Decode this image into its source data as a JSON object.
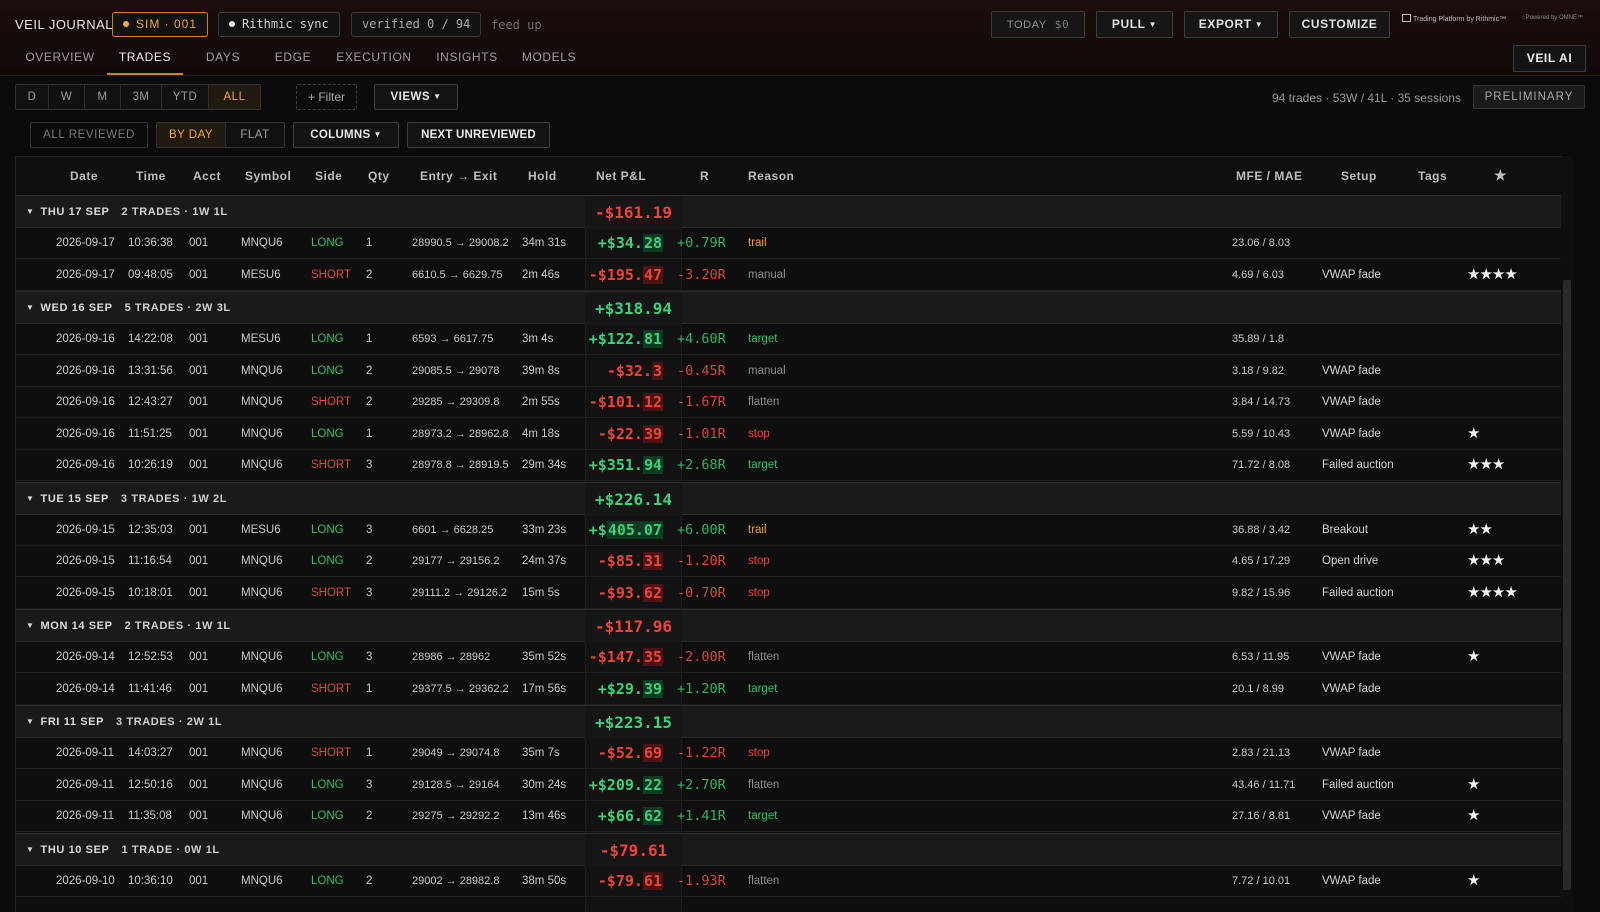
{
  "header": {
    "brand": "VEIL JOURNAL",
    "account_pill": "SIM · 001",
    "sync_pill": "Rithmic sync",
    "verified": "verified 0 / 94",
    "feed": "feed up",
    "today_label": "TODAY",
    "today_value": "$0",
    "pull": "PULL",
    "export": "EXPORT",
    "customize": "CUSTOMIZE",
    "platform_badge": "Trading Platform by Rithmic™",
    "powered": "Powered by OMNE™",
    "veil_ai": "VEIL AI",
    "colors": {
      "accent": "#c58a16",
      "positive": "#3bd27a",
      "negative": "#ee4336"
    }
  },
  "tabs": [
    "OVERVIEW",
    "TRADES",
    "DAYS",
    "EDGE",
    "EXECUTION",
    "INSIGHTS",
    "MODELS"
  ],
  "active_tab": "TRADES",
  "range": {
    "options": [
      "D",
      "W",
      "M",
      "3M",
      "YTD",
      "ALL"
    ],
    "selected": "ALL"
  },
  "filter_label": "+ Filter",
  "views_label": "VIEWS",
  "summary": "94 trades · 53W / 41L · 35 sessions",
  "preliminary": "PRELIMINARY",
  "toolbar": {
    "all_reviewed": "ALL REVIEWED",
    "by_day": "BY DAY",
    "flat": "FLAT",
    "columns": "COLUMNS",
    "next_unreviewed": "NEXT UNREVIEWED"
  },
  "columns": {
    "date": "Date",
    "time": "Time",
    "acct": "Acct",
    "symbol": "Symbol",
    "side": "Side",
    "qty": "Qty",
    "entry_exit": "Entry → Exit",
    "hold": "Hold",
    "net_pnl": "Net P&L",
    "r": "R",
    "reason": "Reason",
    "mfe_mae": "MFE / MAE",
    "setup": "Setup",
    "tags": "Tags",
    "star": "★"
  },
  "groups": [
    {
      "label": "THU 17 SEP",
      "count": "2 TRADES · 1W 1L",
      "pnl": "-$161.19",
      "sign": "neg",
      "trades": [
        {
          "date": "2026-09-17",
          "time": "10:36:38",
          "acct": "001",
          "symbol": "MNQU6",
          "side": "LONG",
          "qty": "1",
          "entry_exit": "28990.5 → 29008.2",
          "hold": "34m 31s",
          "pnl_a": "+$34.",
          "pnl_b": "28",
          "sign": "pos",
          "r": "+0.79R",
          "reason": "trail",
          "mfe_mae": "23.06 / 8.03",
          "setup": "",
          "stars": ""
        },
        {
          "date": "2026-09-17",
          "time": "09:48:05",
          "acct": "001",
          "symbol": "MESU6",
          "side": "SHORT",
          "qty": "2",
          "entry_exit": "6610.5 → 6629.75",
          "hold": "2m 46s",
          "pnl_a": "-$195.",
          "pnl_b": "47",
          "sign": "neg",
          "r": "-3.20R",
          "reason": "manual",
          "mfe_mae": "4.69 / 6.03",
          "setup": "VWAP fade",
          "stars": "★★★★"
        }
      ]
    },
    {
      "label": "WED 16 SEP",
      "count": "5 TRADES · 2W 3L",
      "pnl": "+$318.94",
      "sign": "pos",
      "trades": [
        {
          "date": "2026-09-16",
          "time": "14:22:08",
          "acct": "001",
          "symbol": "MESU6",
          "side": "LONG",
          "qty": "1",
          "entry_exit": "6593 → 6617.75",
          "hold": "3m 4s",
          "pnl_a": "+$122.",
          "pnl_b": "81",
          "sign": "pos",
          "r": "+4.60R",
          "reason": "target",
          "mfe_mae": "35.89 / 1.8",
          "setup": "",
          "stars": ""
        },
        {
          "date": "2026-09-16",
          "time": "13:31:56",
          "acct": "001",
          "symbol": "MNQU6",
          "side": "LONG",
          "qty": "2",
          "entry_exit": "29085.5 → 29078",
          "hold": "39m 8s",
          "pnl_a": "-$32.",
          "pnl_b": "3",
          "sign": "neg",
          "r": "-0.45R",
          "reason": "manual",
          "mfe_mae": "3.18 / 9.82",
          "setup": "VWAP fade",
          "stars": ""
        },
        {
          "date": "2026-09-16",
          "time": "12:43:27",
          "acct": "001",
          "symbol": "MNQU6",
          "side": "SHORT",
          "qty": "2",
          "entry_exit": "29285 → 29309.8",
          "hold": "2m 55s",
          "pnl_a": "-$101.",
          "pnl_b": "12",
          "sign": "neg",
          "r": "-1.67R",
          "reason": "flatten",
          "mfe_mae": "3.84 / 14.73",
          "setup": "VWAP fade",
          "stars": ""
        },
        {
          "date": "2026-09-16",
          "time": "11:51:25",
          "acct": "001",
          "symbol": "MNQU6",
          "side": "LONG",
          "qty": "1",
          "entry_exit": "28973.2 → 28962.8",
          "hold": "4m 18s",
          "pnl_a": "-$22.",
          "pnl_b": "39",
          "sign": "neg",
          "r": "-1.01R",
          "reason": "stop",
          "mfe_mae": "5.59 / 10.43",
          "setup": "VWAP fade",
          "stars": "★"
        },
        {
          "date": "2026-09-16",
          "time": "10:26:19",
          "acct": "001",
          "symbol": "MNQU6",
          "side": "SHORT",
          "qty": "3",
          "entry_exit": "28978.8 → 28919.5",
          "hold": "29m 34s",
          "pnl_a": "+$351.",
          "pnl_b": "94",
          "sign": "pos",
          "r": "+2.68R",
          "reason": "target",
          "mfe_mae": "71.72 / 8.08",
          "setup": "Failed auction",
          "stars": "★★★"
        }
      ]
    },
    {
      "label": "TUE 15 SEP",
      "count": "3 TRADES · 1W 2L",
      "pnl": "+$226.14",
      "sign": "pos",
      "trades": [
        {
          "date": "2026-09-15",
          "time": "12:35:03",
          "acct": "001",
          "symbol": "MESU6",
          "side": "LONG",
          "qty": "3",
          "entry_exit": "6601 → 6628.25",
          "hold": "33m 23s",
          "pnl_a": "+$",
          "pnl_b": "405.07",
          "sign": "pos",
          "r": "+6.00R",
          "reason": "trail",
          "mfe_mae": "36.88 / 3.42",
          "setup": "Breakout",
          "stars": "★★"
        },
        {
          "date": "2026-09-15",
          "time": "11:16:54",
          "acct": "001",
          "symbol": "MNQU6",
          "side": "LONG",
          "qty": "2",
          "entry_exit": "29177 → 29156.2",
          "hold": "24m 37s",
          "pnl_a": "-$85.",
          "pnl_b": "31",
          "sign": "neg",
          "r": "-1.20R",
          "reason": "stop",
          "mfe_mae": "4.65 / 17.29",
          "setup": "Open drive",
          "stars": "★★★"
        },
        {
          "date": "2026-09-15",
          "time": "10:18:01",
          "acct": "001",
          "symbol": "MNQU6",
          "side": "SHORT",
          "qty": "3",
          "entry_exit": "29111.2 → 29126.2",
          "hold": "15m 5s",
          "pnl_a": "-$93.",
          "pnl_b": "62",
          "sign": "neg",
          "r": "-0.70R",
          "reason": "stop",
          "mfe_mae": "9.82 / 15.96",
          "setup": "Failed auction",
          "stars": "★★★★"
        }
      ]
    },
    {
      "label": "MON 14 SEP",
      "count": "2 TRADES · 1W 1L",
      "pnl": "-$117.96",
      "sign": "neg",
      "trades": [
        {
          "date": "2026-09-14",
          "time": "12:52:53",
          "acct": "001",
          "symbol": "MNQU6",
          "side": "LONG",
          "qty": "3",
          "entry_exit": "28986 → 28962",
          "hold": "35m 52s",
          "pnl_a": "-$147.",
          "pnl_b": "35",
          "sign": "neg",
          "r": "-2.00R",
          "reason": "flatten",
          "mfe_mae": "6.53 / 11.95",
          "setup": "VWAP fade",
          "stars": "★"
        },
        {
          "date": "2026-09-14",
          "time": "11:41:46",
          "acct": "001",
          "symbol": "MNQU6",
          "side": "SHORT",
          "qty": "1",
          "entry_exit": "29377.5 → 29362.2",
          "hold": "17m 56s",
          "pnl_a": "+$29.",
          "pnl_b": "39",
          "sign": "pos",
          "r": "+1.20R",
          "reason": "target",
          "mfe_mae": "20.1 / 8.99",
          "setup": "VWAP fade",
          "stars": ""
        }
      ]
    },
    {
      "label": "FRI 11 SEP",
      "count": "3 TRADES · 2W 1L",
      "pnl": "+$223.15",
      "sign": "pos",
      "trades": [
        {
          "date": "2026-09-11",
          "time": "14:03:27",
          "acct": "001",
          "symbol": "MNQU6",
          "side": "SHORT",
          "qty": "1",
          "entry_exit": "29049 → 29074.8",
          "hold": "35m 7s",
          "pnl_a": "-$52.",
          "pnl_b": "69",
          "sign": "neg",
          "r": "-1.22R",
          "reason": "stop",
          "mfe_mae": "2.83 / 21.13",
          "setup": "VWAP fade",
          "stars": ""
        },
        {
          "date": "2026-09-11",
          "time": "12:50:16",
          "acct": "001",
          "symbol": "MNQU6",
          "side": "LONG",
          "qty": "3",
          "entry_exit": "29128.5 → 29164",
          "hold": "30m 24s",
          "pnl_a": "+$209.",
          "pnl_b": "22",
          "sign": "pos",
          "r": "+2.70R",
          "reason": "flatten",
          "mfe_mae": "43.46 / 11.71",
          "setup": "Failed auction",
          "stars": "★"
        },
        {
          "date": "2026-09-11",
          "time": "11:35:08",
          "acct": "001",
          "symbol": "MNQU6",
          "side": "LONG",
          "qty": "2",
          "entry_exit": "29275 → 29292.2",
          "hold": "13m 46s",
          "pnl_a": "+$66.",
          "pnl_b": "62",
          "sign": "pos",
          "r": "+1.41R",
          "reason": "target",
          "mfe_mae": "27.16 / 8.81",
          "setup": "VWAP fade",
          "stars": "★"
        }
      ]
    },
    {
      "label": "THU 10 SEP",
      "count": "1 TRADE · 0W 1L",
      "pnl": "-$79.61",
      "sign": "neg",
      "trades": [
        {
          "date": "2026-09-10",
          "time": "10:36:10",
          "acct": "001",
          "symbol": "MNQU6",
          "side": "LONG",
          "qty": "2",
          "entry_exit": "29002 → 28982.8",
          "hold": "38m 50s",
          "pnl_a": "-$79.",
          "pnl_b": "61",
          "sign": "neg",
          "r": "-1.93R",
          "reason": "flatten",
          "mfe_mae": "7.72 / 10.01",
          "setup": "VWAP fade",
          "stars": "★"
        }
      ]
    }
  ]
}
